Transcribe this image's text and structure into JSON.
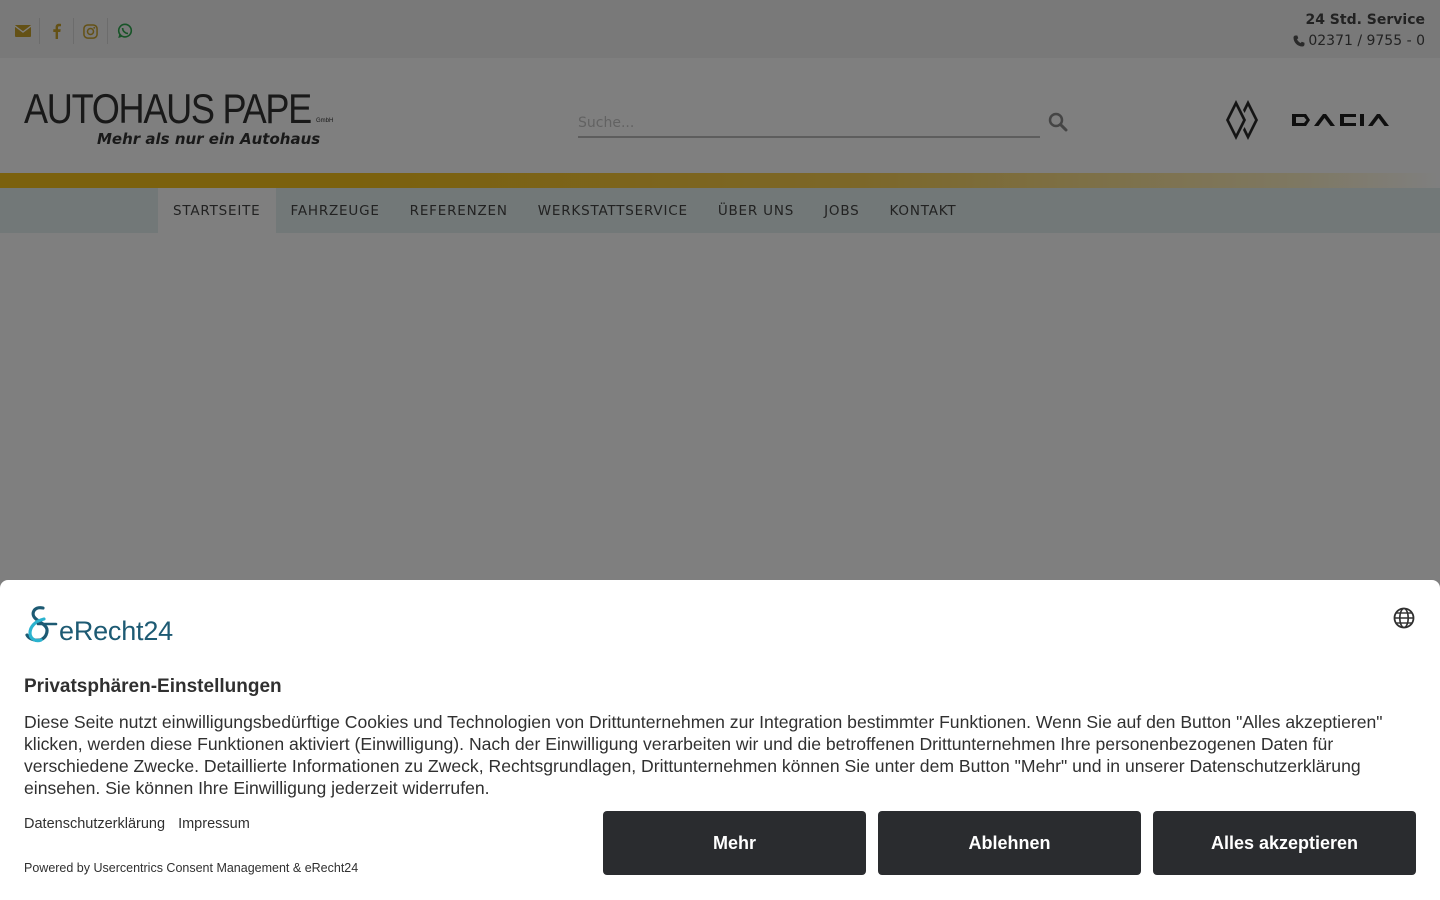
{
  "topbar": {
    "service_title": "24 Std. Service",
    "service_phone": "02371 / 9755 - 0",
    "social_icons": [
      "envelope-icon",
      "facebook-icon",
      "instagram-icon",
      "whatsapp-icon"
    ]
  },
  "header": {
    "logo_title": "AUTOHAUS PAPE",
    "logo_suffix": "GmbH",
    "logo_tagline": "Mehr als nur ein Autohaus",
    "search_placeholder": "Suche...",
    "brands": [
      "renault-logo",
      "dacia-logo"
    ]
  },
  "nav": {
    "items": [
      {
        "label": "STARTSEITE",
        "active": true
      },
      {
        "label": "FAHRZEUGE"
      },
      {
        "label": "REFERENZEN"
      },
      {
        "label": "WERKSTATTSERVICE"
      },
      {
        "label": "ÜBER UNS"
      },
      {
        "label": "JOBS"
      },
      {
        "label": "KONTAKT"
      }
    ]
  },
  "consent": {
    "brand_name": "eRecht24",
    "title": "Privatsphären-Einstellungen",
    "description": "Diese Seite nutzt einwilligungsbedürftige Cookies und Technologien von Drittunternehmen zur Integration bestimmter Funktionen. Wenn Sie auf den Button \"Alles akzeptieren\" klicken, werden diese Funktionen aktiviert (Einwilligung). Nach der Einwilligung verarbeiten wir und die betroffenen Drittunternehmen Ihre personenbezogenen Daten für verschiedene Zwecke. Detaillierte Informationen zu Zweck, Rechtsgrundlagen, Drittunternehmen können Sie unter dem Button \"Mehr\" und in unserer Datenschutzerklärung einsehen. Sie können Ihre Einwilligung jederzeit widerrufen.",
    "link_privacy": "Datenschutzerklärung",
    "link_imprint": "Impressum",
    "powered_by": "Powered by Usercentrics Consent Management & eRecht24",
    "btn_more": "Mehr",
    "btn_deny": "Ablehnen",
    "btn_accept": "Alles akzeptieren"
  },
  "colors": {
    "accent_yellow": "#f7c21b",
    "nav_background": "#e4f1f0",
    "button_dark": "#2a2c2f",
    "brand_teal": "#1d5a73"
  }
}
